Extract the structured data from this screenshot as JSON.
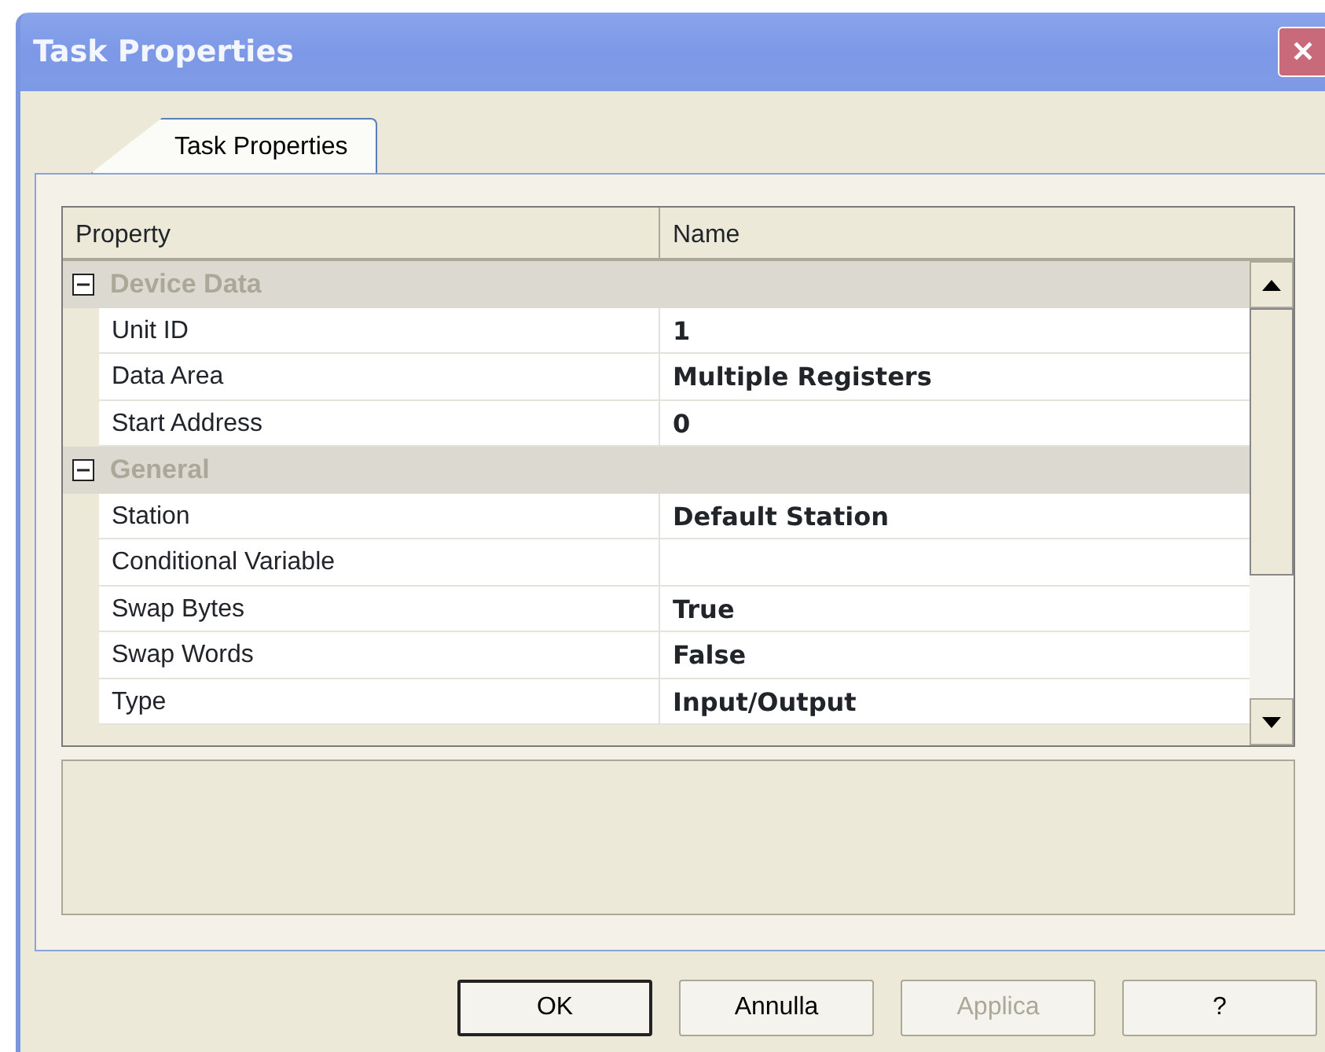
{
  "window": {
    "title": "Task Properties",
    "close": "✕"
  },
  "tabs": [
    {
      "label": "Task Properties",
      "selected": true
    }
  ],
  "grid": {
    "columns": [
      "Property",
      "Name"
    ],
    "groups": [
      {
        "title": "Device Data",
        "expanded": true,
        "rows": [
          {
            "property": "Unit ID",
            "value": "1"
          },
          {
            "property": "Data Area",
            "value": "Multiple Registers"
          },
          {
            "property": "Start Address",
            "value": "0"
          }
        ]
      },
      {
        "title": "General",
        "expanded": true,
        "rows": [
          {
            "property": "Station",
            "value": "Default Station"
          },
          {
            "property": "Conditional Variable"
          },
          {
            "property": "Swap Bytes",
            "value": "True"
          },
          {
            "property": "Swap Words",
            "value": "False"
          },
          {
            "property": "Type",
            "value": "Input/Output"
          }
        ]
      }
    ]
  },
  "buttons": [
    {
      "label": "OK",
      "default": true,
      "disabled": false
    },
    {
      "label": "Annulla",
      "default": false,
      "disabled": false
    },
    {
      "label": "Applica",
      "default": false,
      "disabled": true
    },
    {
      "label": "?",
      "default": false,
      "disabled": false
    }
  ]
}
